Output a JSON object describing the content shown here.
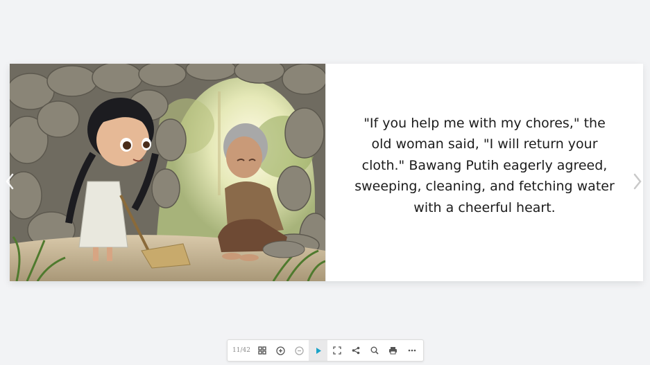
{
  "flipbook": {
    "story_text": "\"If you help me with my chores,\" the old woman said, \"I will return your cloth.\" Bawang Putih eagerly agreed, sweeping, cleaning, and fetching water with a cheerful heart.",
    "illustration": "girl-sweeping-cave-with-old-woman",
    "nav": {
      "prev_icon": "chevron-left-icon",
      "next_icon": "chevron-right-icon"
    }
  },
  "toolbar": {
    "page_counter": "11/42",
    "buttons": [
      {
        "icon": "grid-icon"
      },
      {
        "icon": "zoom-in-icon"
      },
      {
        "icon": "zoom-out-icon"
      },
      {
        "icon": "play-icon",
        "active": true
      },
      {
        "icon": "fullscreen-icon"
      },
      {
        "icon": "share-icon"
      },
      {
        "icon": "search-icon"
      },
      {
        "icon": "print-icon"
      },
      {
        "icon": "more-icon"
      }
    ],
    "accent_color": "#1aa3c8"
  },
  "colors": {
    "background": "#f2f3f5",
    "page": "#ffffff",
    "text": "#1b1b1b"
  }
}
